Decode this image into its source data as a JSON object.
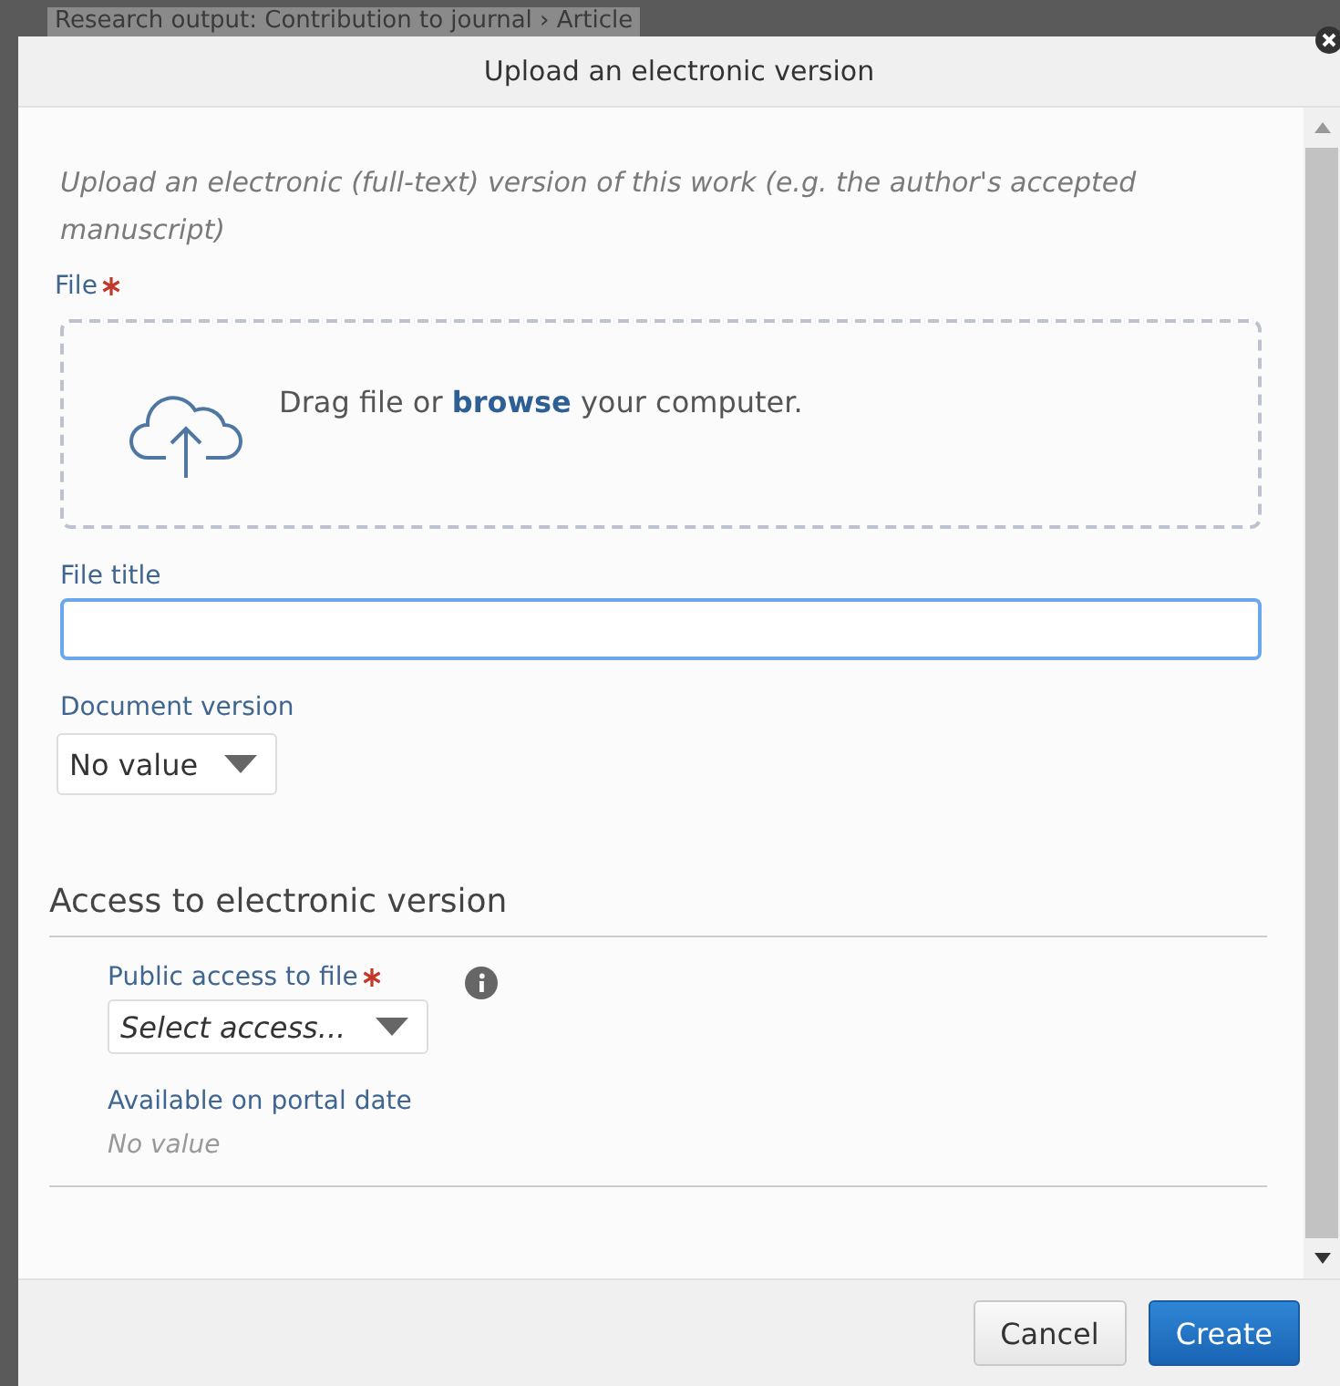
{
  "background": {
    "breadcrumb": "Research output: Contribution to journal › Article"
  },
  "dialog": {
    "title": "Upload an electronic version",
    "intro": "Upload an electronic (full-text) version of this work (e.g. the author's accepted manuscript)",
    "file": {
      "label": "File",
      "required": true,
      "drop_text_before": "Drag file or",
      "drop_link": "browse",
      "drop_text_after": "your computer."
    },
    "file_title": {
      "label": "File title",
      "focused": true
    },
    "document_version": {
      "label": "Document version",
      "value": "No value"
    },
    "access_section": {
      "heading": "Access to electronic version",
      "public_access": {
        "label": "Public access to file",
        "required": true,
        "placeholder": "Select access..."
      },
      "portal_date": {
        "label": "Available on portal date",
        "value": "No value"
      }
    },
    "buttons": [
      {
        "label": "Cancel",
        "kind": "secondary"
      },
      {
        "label": "Create",
        "kind": "primary"
      }
    ]
  }
}
